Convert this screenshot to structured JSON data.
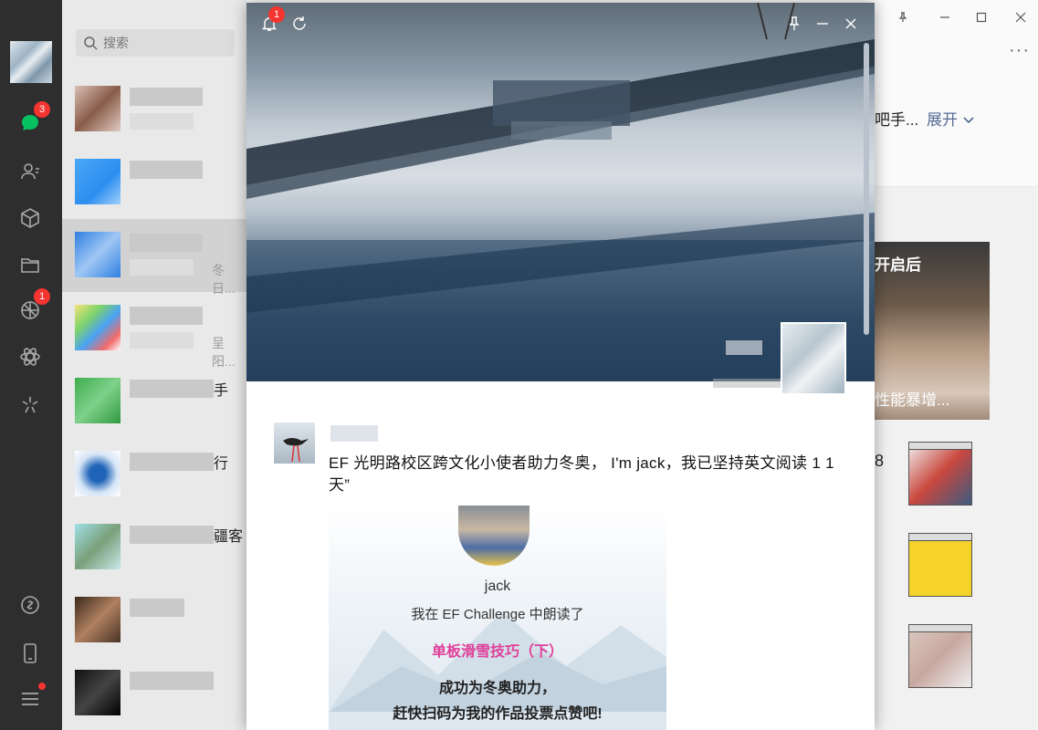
{
  "navbar": {
    "items": [
      {
        "name": "chat-icon",
        "badge": "3"
      },
      {
        "name": "contacts-icon"
      },
      {
        "name": "favorites-icon"
      },
      {
        "name": "files-icon"
      },
      {
        "name": "moments-icon",
        "badge": "1"
      },
      {
        "name": "mini-programs-icon"
      },
      {
        "name": "channels-icon"
      },
      {
        "name": "link-icon"
      },
      {
        "name": "phone-icon"
      },
      {
        "name": "menu-icon"
      }
    ],
    "accent": "#07c160",
    "badge_color": "#f43530"
  },
  "search": {
    "placeholder": "搜索"
  },
  "chat_list": {
    "items": [
      {
        "peek": "",
        "peek_msg": ""
      },
      {
        "peek": "",
        "peek_msg": ""
      },
      {
        "peek": "",
        "peek_msg": "冬日..."
      },
      {
        "peek": "",
        "peek_msg": "呈阳..."
      },
      {
        "peek": "手",
        "peek_msg": ""
      },
      {
        "peek": "行",
        "peek_msg": ""
      },
      {
        "peek": "疆客",
        "peek_msg": ""
      },
      {
        "peek": "",
        "peek_msg": ""
      },
      {
        "peek": "",
        "peek_msg": ""
      }
    ]
  },
  "main": {
    "title_peek": "吧手...",
    "expand_label": "展开",
    "more_label": "···",
    "card_top": "开启后",
    "card_bottom": "性能暴增...",
    "card_number": "8"
  },
  "moments": {
    "notification_count": "1",
    "post": {
      "text": "EF 光明路校区跨文化小使者助力冬奥， I'm jack，我已坚持英文阅读 1 1天”",
      "image": {
        "name": "jack",
        "line1": "我在  EF Challenge  中朗读了",
        "line2": "单板滑雪技巧（下）",
        "line3": "成功为冬奥助力，",
        "line4": "赶快扫码为我的作品投票点赞吧!"
      }
    }
  }
}
